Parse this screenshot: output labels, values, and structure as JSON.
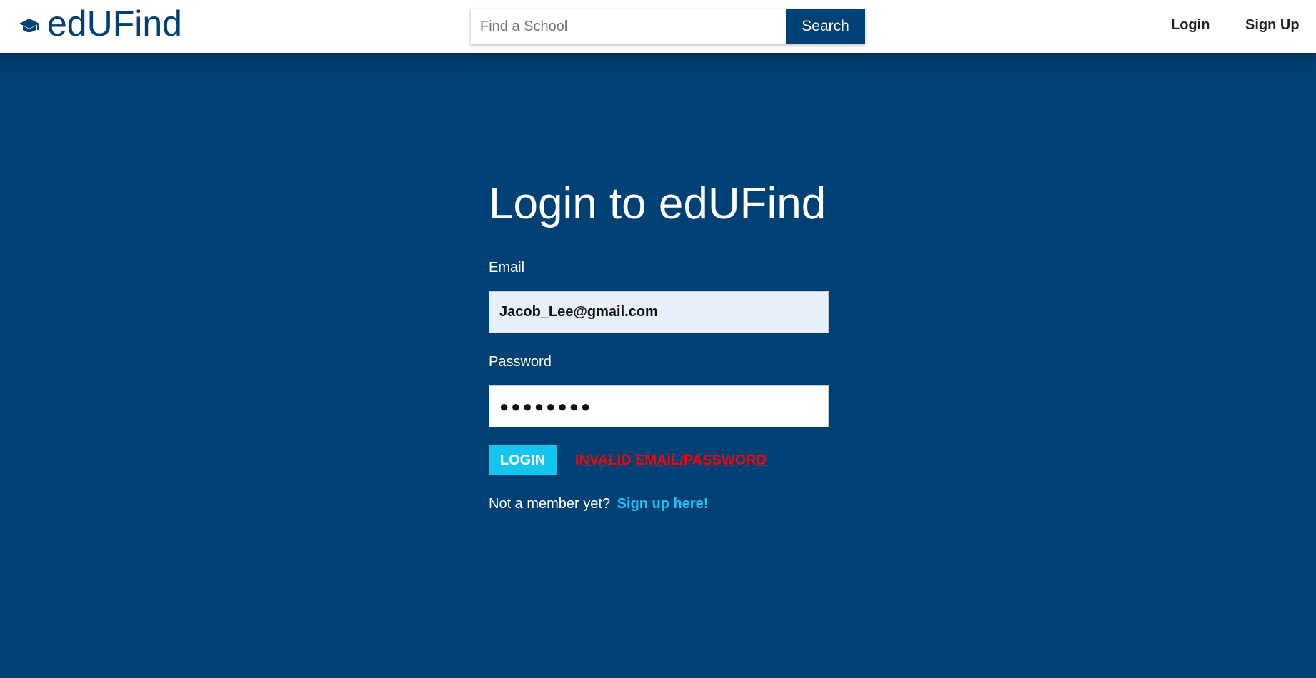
{
  "colors": {
    "brand": "#004175",
    "accent": "#16c5ee",
    "error": "#ff0000",
    "email_autofill_bg": "#e8f0fe"
  },
  "header": {
    "logo_icon": "graduation-cap-icon",
    "brand_name": "edUFind",
    "search": {
      "placeholder": "Find a School",
      "value": "",
      "button_label": "Search"
    },
    "nav": {
      "login": "Login",
      "signup": "Sign Up"
    }
  },
  "login_form": {
    "title": "Login to edUFind",
    "email_label": "Email",
    "email_value": "Jacob_Lee@gmail.com",
    "password_label": "Password",
    "password_value": "●●●●●●●●",
    "login_button": "LOGIN",
    "error_message": "INVALID EMAIL/PASSWORD",
    "signup_prompt": "Not a member yet?",
    "signup_link": "Sign up here!"
  }
}
